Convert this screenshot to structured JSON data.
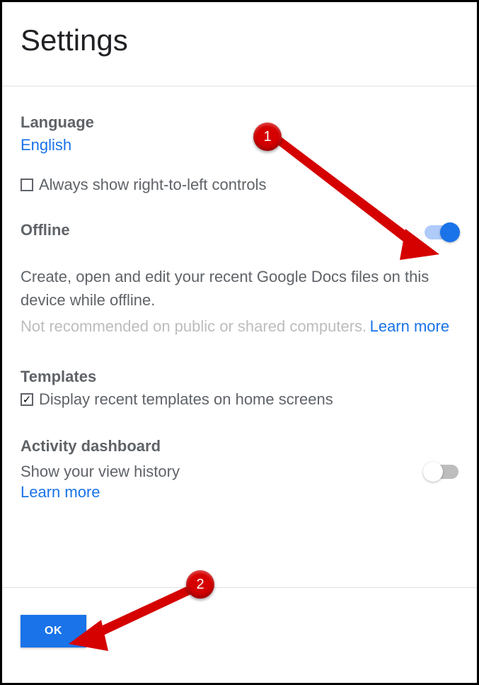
{
  "header": {
    "title": "Settings"
  },
  "language": {
    "label": "Language",
    "value": "English",
    "rtl_checkbox_label": "Always show right-to-left controls",
    "rtl_checked": false
  },
  "offline": {
    "label": "Offline",
    "toggle_on": true,
    "description": "Create, open and edit your recent Google Docs files on this device while offline.",
    "warning": "Not recommended on public or shared computers.",
    "learn_more": "Learn more"
  },
  "templates": {
    "label": "Templates",
    "checkbox_label": "Display recent templates on home screens",
    "checked": true
  },
  "activity": {
    "label": "Activity dashboard",
    "description": "Show your view history",
    "toggle_on": false,
    "learn_more": "Learn more"
  },
  "footer": {
    "ok": "OK"
  },
  "annotations": {
    "badge1": "1",
    "badge2": "2"
  }
}
